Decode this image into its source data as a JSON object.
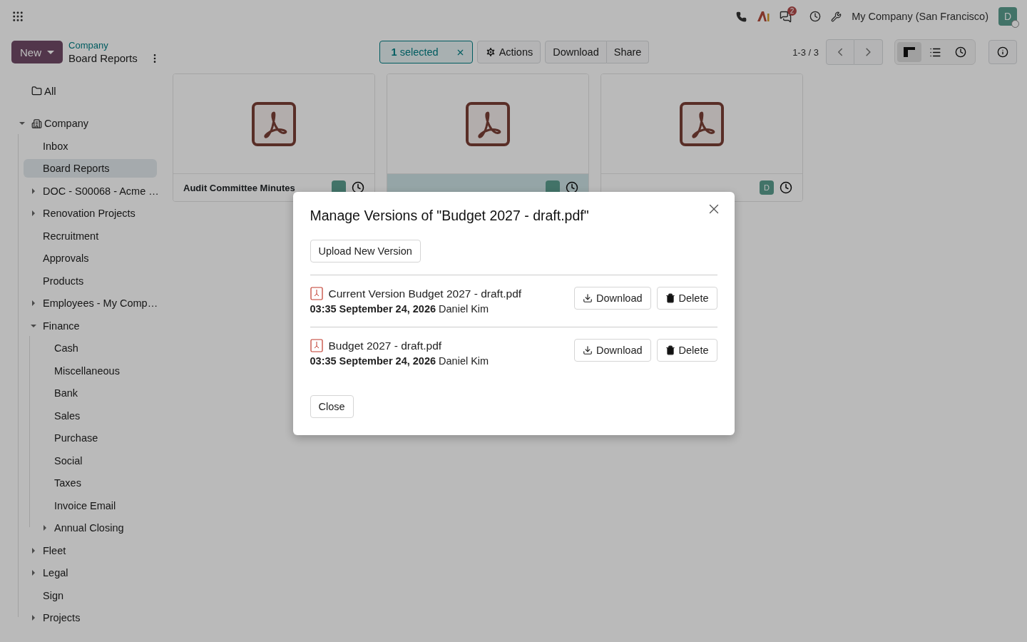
{
  "navbar": {
    "company": "My Company (San Francisco)",
    "message_count": "2",
    "avatar": "D"
  },
  "control_panel": {
    "new_button": "New",
    "breadcrumb": "Company",
    "title": "Board Reports",
    "selection": "**1** selected",
    "actions": "Actions",
    "buttons": [
      "Download",
      "Share"
    ],
    "pager": "1-3 / 3",
    "views": [
      {
        "kind": "kanban",
        "selected": true
      },
      {
        "kind": "list",
        "selected": false
      },
      {
        "kind": "activity",
        "selected": false
      }
    ]
  },
  "sidebar": {
    "all": "All",
    "tree": [
      {
        "label": "Company",
        "kind": "expanded",
        "building": true,
        "selected": false,
        "children": [
          {
            "label": "Inbox",
            "kind": "leaf",
            "selected": false
          },
          {
            "label": "Board Reports",
            "kind": "leaf",
            "selected": true
          },
          {
            "label": "DOC - S00068 - Acme …",
            "kind": "collapsed",
            "selected": false
          },
          {
            "label": "Renovation Projects",
            "kind": "collapsed",
            "selected": false
          },
          {
            "label": "Recruitment",
            "kind": "leaf",
            "selected": false
          },
          {
            "label": "Approvals",
            "kind": "leaf",
            "selected": false
          },
          {
            "label": "Products",
            "kind": "leaf",
            "selected": false
          },
          {
            "label": "Employees - My Comp…",
            "kind": "collapsed",
            "selected": false
          },
          {
            "label": "Finance",
            "kind": "expanded",
            "selected": false,
            "children": [
              {
                "label": "Cash",
                "kind": "leaf",
                "selected": false
              },
              {
                "label": "Miscellaneous",
                "kind": "leaf",
                "selected": false
              },
              {
                "label": "Bank",
                "kind": "leaf",
                "selected": false
              },
              {
                "label": "Sales",
                "kind": "leaf",
                "selected": false
              },
              {
                "label": "Purchase",
                "kind": "leaf",
                "selected": false
              },
              {
                "label": "Social",
                "kind": "leaf",
                "selected": false
              },
              {
                "label": "Taxes",
                "kind": "leaf",
                "selected": false
              },
              {
                "label": "Invoice Email",
                "kind": "leaf",
                "selected": false
              },
              {
                "label": "Annual Closing",
                "kind": "collapsed",
                "selected": false
              }
            ]
          },
          {
            "label": "Fleet",
            "kind": "collapsed",
            "selected": false
          },
          {
            "label": "Legal",
            "kind": "collapsed",
            "selected": false
          },
          {
            "label": "Sign",
            "kind": "leaf",
            "selected": false
          },
          {
            "label": "Projects",
            "kind": "collapsed",
            "selected": false
          }
        ]
      }
    ]
  },
  "cards": [
    {
      "title": "Audit Committee Minutes",
      "selected": false
    },
    {
      "selected": true
    },
    {
      "selected": false,
      "avatar": "D"
    }
  ],
  "dialog": {
    "title": "Manage Versions of \"Budget 2027 - draft.pdf\"",
    "upload_button": "Upload New Version",
    "versions": [
      {
        "name": "Current Version Budget 2027 - draft.pdf",
        "meta": "**03:35 September 24, 2026** Daniel Kim",
        "download": "Download",
        "delete": "Delete"
      },
      {
        "name": "Budget 2027 - draft.pdf",
        "meta": "**03:35 September 24, 2026** Daniel Kim",
        "download": "Download",
        "delete": "Delete"
      }
    ],
    "close_button": "Close"
  }
}
